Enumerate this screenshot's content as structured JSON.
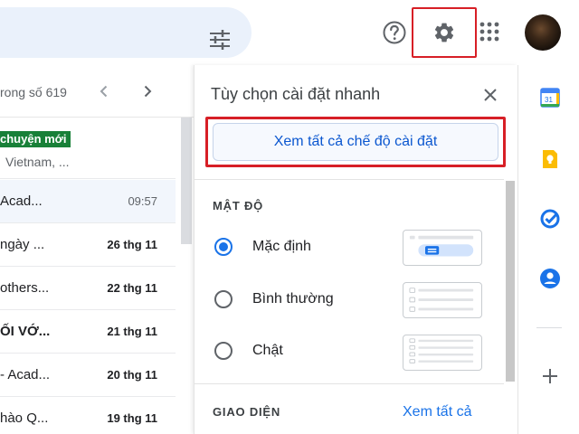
{
  "mail_list": {
    "pager_text": "rong số 619",
    "first_row": {
      "badge": "chuyện mới",
      "sub": "Vietnam, ..."
    },
    "rows": [
      {
        "subject": "Acad...",
        "date": "09:57",
        "style": "read"
      },
      {
        "subject": "ngày ...",
        "date": "26 thg 11",
        "style": "unread"
      },
      {
        "subject": "others...",
        "date": "22 thg 11",
        "style": "unread"
      },
      {
        "subject": "ỐI VỚ...",
        "date": "21 thg 11",
        "style": "bold"
      },
      {
        "subject": "- Acad...",
        "date": "20 thg 11",
        "style": "unread"
      },
      {
        "subject": "hào Q...",
        "date": "19 thg 11",
        "style": "unread"
      }
    ]
  },
  "quick_settings": {
    "title": "Tùy chọn cài đặt nhanh",
    "see_all_button": "Xem tất cả chế độ cài đặt",
    "density_label": "MẬT ĐỘ",
    "options": [
      {
        "label": "Mặc định",
        "checked": true
      },
      {
        "label": "Bình thường",
        "checked": false
      },
      {
        "label": "Chật",
        "checked": false
      }
    ],
    "theme_label": "GIAO DIỆN",
    "theme_link": "Xem tất cả"
  },
  "side_panel": {
    "icons": [
      "calendar-icon",
      "keep-icon",
      "tasks-icon",
      "contacts-icon",
      "add-icon"
    ],
    "calendar_day": "31"
  },
  "colors": {
    "accent": "#1a73e8",
    "highlight": "#d71f26",
    "badge": "#188038"
  }
}
